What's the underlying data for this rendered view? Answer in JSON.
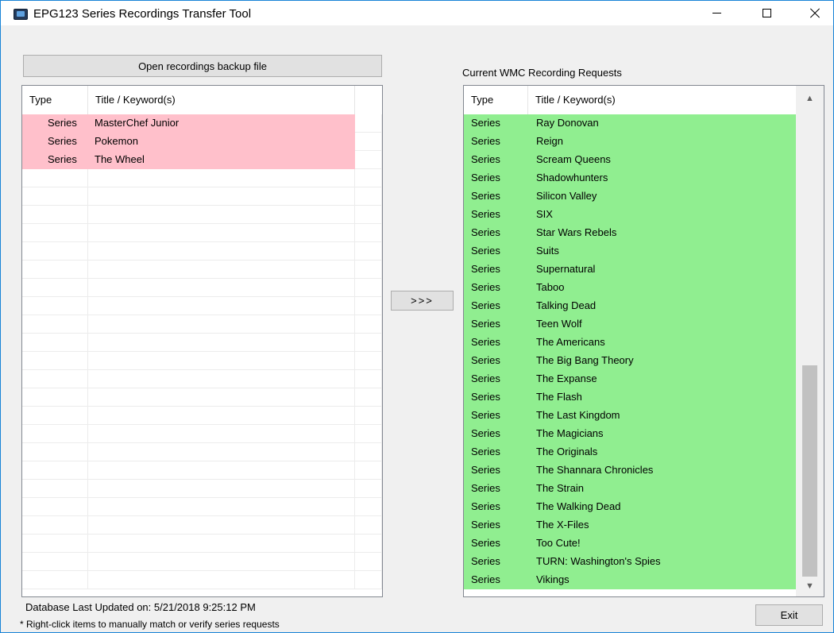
{
  "window": {
    "title": "EPG123 Series Recordings Transfer Tool"
  },
  "open_button_label": "Open recordings backup file",
  "transfer_button_label": ">>>",
  "exit_button_label": "Exit",
  "left_list": {
    "columns": [
      "Type",
      "Title / Keyword(s)"
    ],
    "rows": [
      {
        "type": "Series",
        "title": "MasterChef Junior",
        "checked": false
      },
      {
        "type": "Series",
        "title": "Pokemon",
        "checked": false
      },
      {
        "type": "Series",
        "title": "The Wheel",
        "checked": false
      }
    ],
    "row_color": "#ffc0cb"
  },
  "right_list": {
    "label": "Current WMC Recording Requests",
    "columns": [
      "Type",
      "Title / Keyword(s)"
    ],
    "rows": [
      {
        "type": "Series",
        "title": "Ray Donovan"
      },
      {
        "type": "Series",
        "title": "Reign"
      },
      {
        "type": "Series",
        "title": "Scream Queens"
      },
      {
        "type": "Series",
        "title": "Shadowhunters"
      },
      {
        "type": "Series",
        "title": "Silicon Valley"
      },
      {
        "type": "Series",
        "title": "SIX"
      },
      {
        "type": "Series",
        "title": "Star Wars Rebels"
      },
      {
        "type": "Series",
        "title": "Suits"
      },
      {
        "type": "Series",
        "title": "Supernatural"
      },
      {
        "type": "Series",
        "title": "Taboo"
      },
      {
        "type": "Series",
        "title": "Talking Dead"
      },
      {
        "type": "Series",
        "title": "Teen Wolf"
      },
      {
        "type": "Series",
        "title": "The Americans"
      },
      {
        "type": "Series",
        "title": "The Big Bang Theory"
      },
      {
        "type": "Series",
        "title": "The Expanse"
      },
      {
        "type": "Series",
        "title": "The Flash"
      },
      {
        "type": "Series",
        "title": "The Last Kingdom"
      },
      {
        "type": "Series",
        "title": "The Magicians"
      },
      {
        "type": "Series",
        "title": "The Originals"
      },
      {
        "type": "Series",
        "title": "The Shannara Chronicles"
      },
      {
        "type": "Series",
        "title": "The Strain"
      },
      {
        "type": "Series",
        "title": "The Walking Dead"
      },
      {
        "type": "Series",
        "title": "The X-Files"
      },
      {
        "type": "Series",
        "title": "Too Cute!"
      },
      {
        "type": "Series",
        "title": "TURN: Washington's Spies"
      },
      {
        "type": "Series",
        "title": "Vikings"
      }
    ],
    "row_color": "#90ee90"
  },
  "status": {
    "database_updated": "Database Last Updated on: 5/21/2018 9:25:12 PM",
    "hint": "* Right-click items to manually match or verify series requests"
  },
  "icons": {
    "app": "tv-window-icon",
    "minimize": "minimize-icon",
    "maximize": "maximize-icon",
    "close": "close-icon",
    "scroll_up": "chevron-up-icon",
    "scroll_down": "chevron-down-icon"
  },
  "colors": {
    "title_border": "#1883d7",
    "window_bg": "#f0f0f0"
  }
}
